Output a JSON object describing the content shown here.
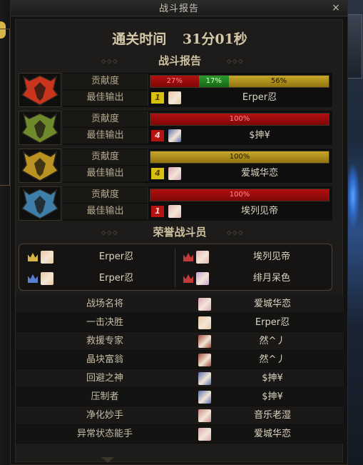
{
  "window": {
    "title": "战斗报告",
    "close_glyph": "×"
  },
  "clear_time": {
    "label": "通关时间",
    "value": "31分01秒"
  },
  "report_heading": "战斗报告",
  "honor_heading": "荣誉战斗员",
  "labels": {
    "contribution": "贡献度",
    "best_output": "最佳输出"
  },
  "teams": [
    {
      "emblem": "fire-emblem-icon",
      "emblem_color": "#c8341c",
      "segments": [
        {
          "color": "red",
          "pct": 27,
          "text": "27%"
        },
        {
          "color": "green",
          "pct": 17,
          "text": "17%"
        },
        {
          "color": "gold",
          "pct": 56,
          "text": "56%"
        }
      ],
      "rank": "1",
      "rank_color": "yellow",
      "player": "Erper忍"
    },
    {
      "emblem": "forest-emblem-icon",
      "emblem_color": "#6f8a2a",
      "segments": [
        {
          "color": "red",
          "pct": 100,
          "text": "100%"
        }
      ],
      "rank": "4",
      "rank_color": "red",
      "player": "$抻¥"
    },
    {
      "emblem": "gold-emblem-icon",
      "emblem_color": "#b99222",
      "segments": [
        {
          "color": "gold",
          "pct": 100,
          "text": "100%"
        }
      ],
      "rank": "4",
      "rank_color": "yellow",
      "player": "爱城华恋"
    },
    {
      "emblem": "ice-emblem-icon",
      "emblem_color": "#3d7fa8",
      "segments": [
        {
          "color": "red",
          "pct": 100,
          "text": "100%"
        }
      ],
      "rank": "1",
      "rank_color": "red",
      "player": "埃列见帝"
    }
  ],
  "honor": [
    {
      "name": "Erper忍",
      "crown": "gold-crown-icon",
      "avatar": "#e8c8a0"
    },
    {
      "name": "埃列见帝",
      "crown": "red-crown-icon",
      "avatar": "#e6b4b4"
    },
    {
      "name": "Erper忍",
      "crown": "blue-crown-icon",
      "avatar": "#e8c8a0"
    },
    {
      "name": "绯月呆色",
      "crown": "red-crown-icon",
      "avatar": "#c9a2d8"
    }
  ],
  "awards": [
    {
      "title": "战场名将",
      "winner": "爱城华恋",
      "avatar": "#d8a6b8"
    },
    {
      "title": "一击决胜",
      "winner": "Erper忍",
      "avatar": "#e8c8a0"
    },
    {
      "title": "救援专家",
      "winner": "然^丿",
      "avatar": "#a44a3a"
    },
    {
      "title": "晶块富翁",
      "winner": "然^丿",
      "avatar": "#a44a3a"
    },
    {
      "title": "回避之神",
      "winner": "$抻¥",
      "avatar": "#5a6fb0"
    },
    {
      "title": "压制者",
      "winner": "$抻¥",
      "avatar": "#5a6fb0"
    },
    {
      "title": "净化妙手",
      "winner": "音乐老湿",
      "avatar": "#c98a8a"
    },
    {
      "title": "异常状态能手",
      "winner": "爱城华恋",
      "avatar": "#d8a6b8"
    }
  ]
}
